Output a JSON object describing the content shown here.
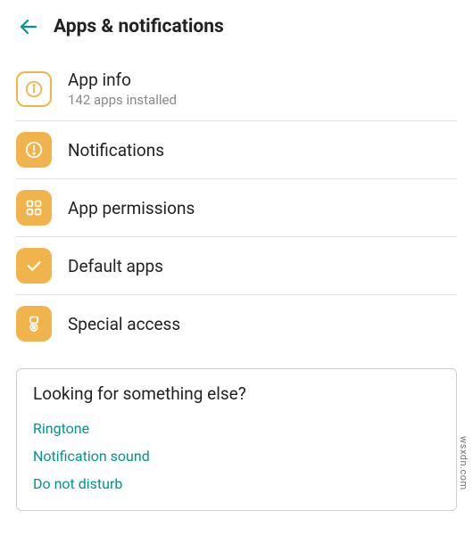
{
  "header": {
    "title": "Apps & notifications"
  },
  "items": [
    {
      "title": "App info",
      "subtitle": "142 apps installed"
    },
    {
      "title": "Notifications"
    },
    {
      "title": "App permissions"
    },
    {
      "title": "Default apps"
    },
    {
      "title": "Special access"
    }
  ],
  "hint": {
    "title": "Looking for something else?",
    "links": [
      "Ringtone",
      "Notification sound",
      "Do not disturb"
    ]
  },
  "colors": {
    "accent": "#f1b44c",
    "teal": "#009688"
  },
  "watermark": "wsxdn.com"
}
